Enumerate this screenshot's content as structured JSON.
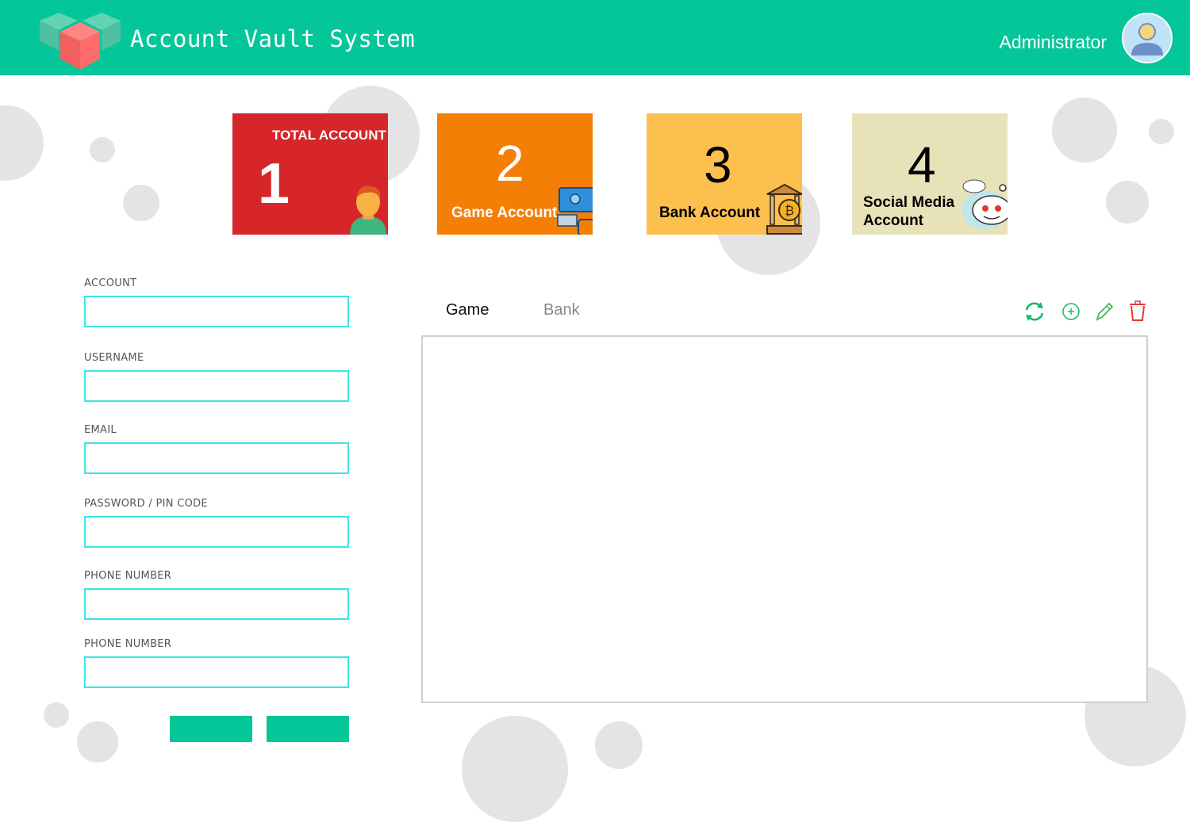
{
  "colors": {
    "brand": "#03c699",
    "card_total": "#d6262a",
    "card_game": "#f57f04",
    "card_bank": "#fdbf4d",
    "card_social": "#e8e2b9",
    "input_border": "#3ce6e6",
    "delete": "#e33b3b"
  },
  "header": {
    "title": "Account Vault System",
    "user": "Administrator",
    "logo_icon": "cube-logo-icon",
    "avatar_icon": "user-avatar-icon"
  },
  "cards": {
    "total": {
      "label": "TOTAL ACCOUNT",
      "value": "1",
      "icon": "person-icon"
    },
    "game": {
      "label": "Game Account",
      "value": "2",
      "icon": "game-controller-icon"
    },
    "bank": {
      "label": "Bank Account",
      "value": "3",
      "icon": "bank-bitcoin-icon"
    },
    "social": {
      "label_line1": "Social Media",
      "label_line2": "Account",
      "value": "4",
      "icon": "reddit-icon"
    }
  },
  "form": {
    "fields": [
      {
        "label": "ACCOUNT",
        "value": ""
      },
      {
        "label": "USERNAME",
        "value": ""
      },
      {
        "label": "EMAIL",
        "value": ""
      },
      {
        "label": "PASSWORD / PIN CODE",
        "value": ""
      },
      {
        "label": "PHONE NUMBER",
        "value": ""
      },
      {
        "label": "PHONE NUMBER",
        "value": ""
      }
    ]
  },
  "tabs": [
    {
      "label": "Game",
      "active": true
    },
    {
      "label": "Bank",
      "active": false
    }
  ],
  "toolbar": {
    "icons": [
      "refresh-icon",
      "add-circle-icon",
      "edit-pencil-icon",
      "delete-trash-icon"
    ]
  }
}
